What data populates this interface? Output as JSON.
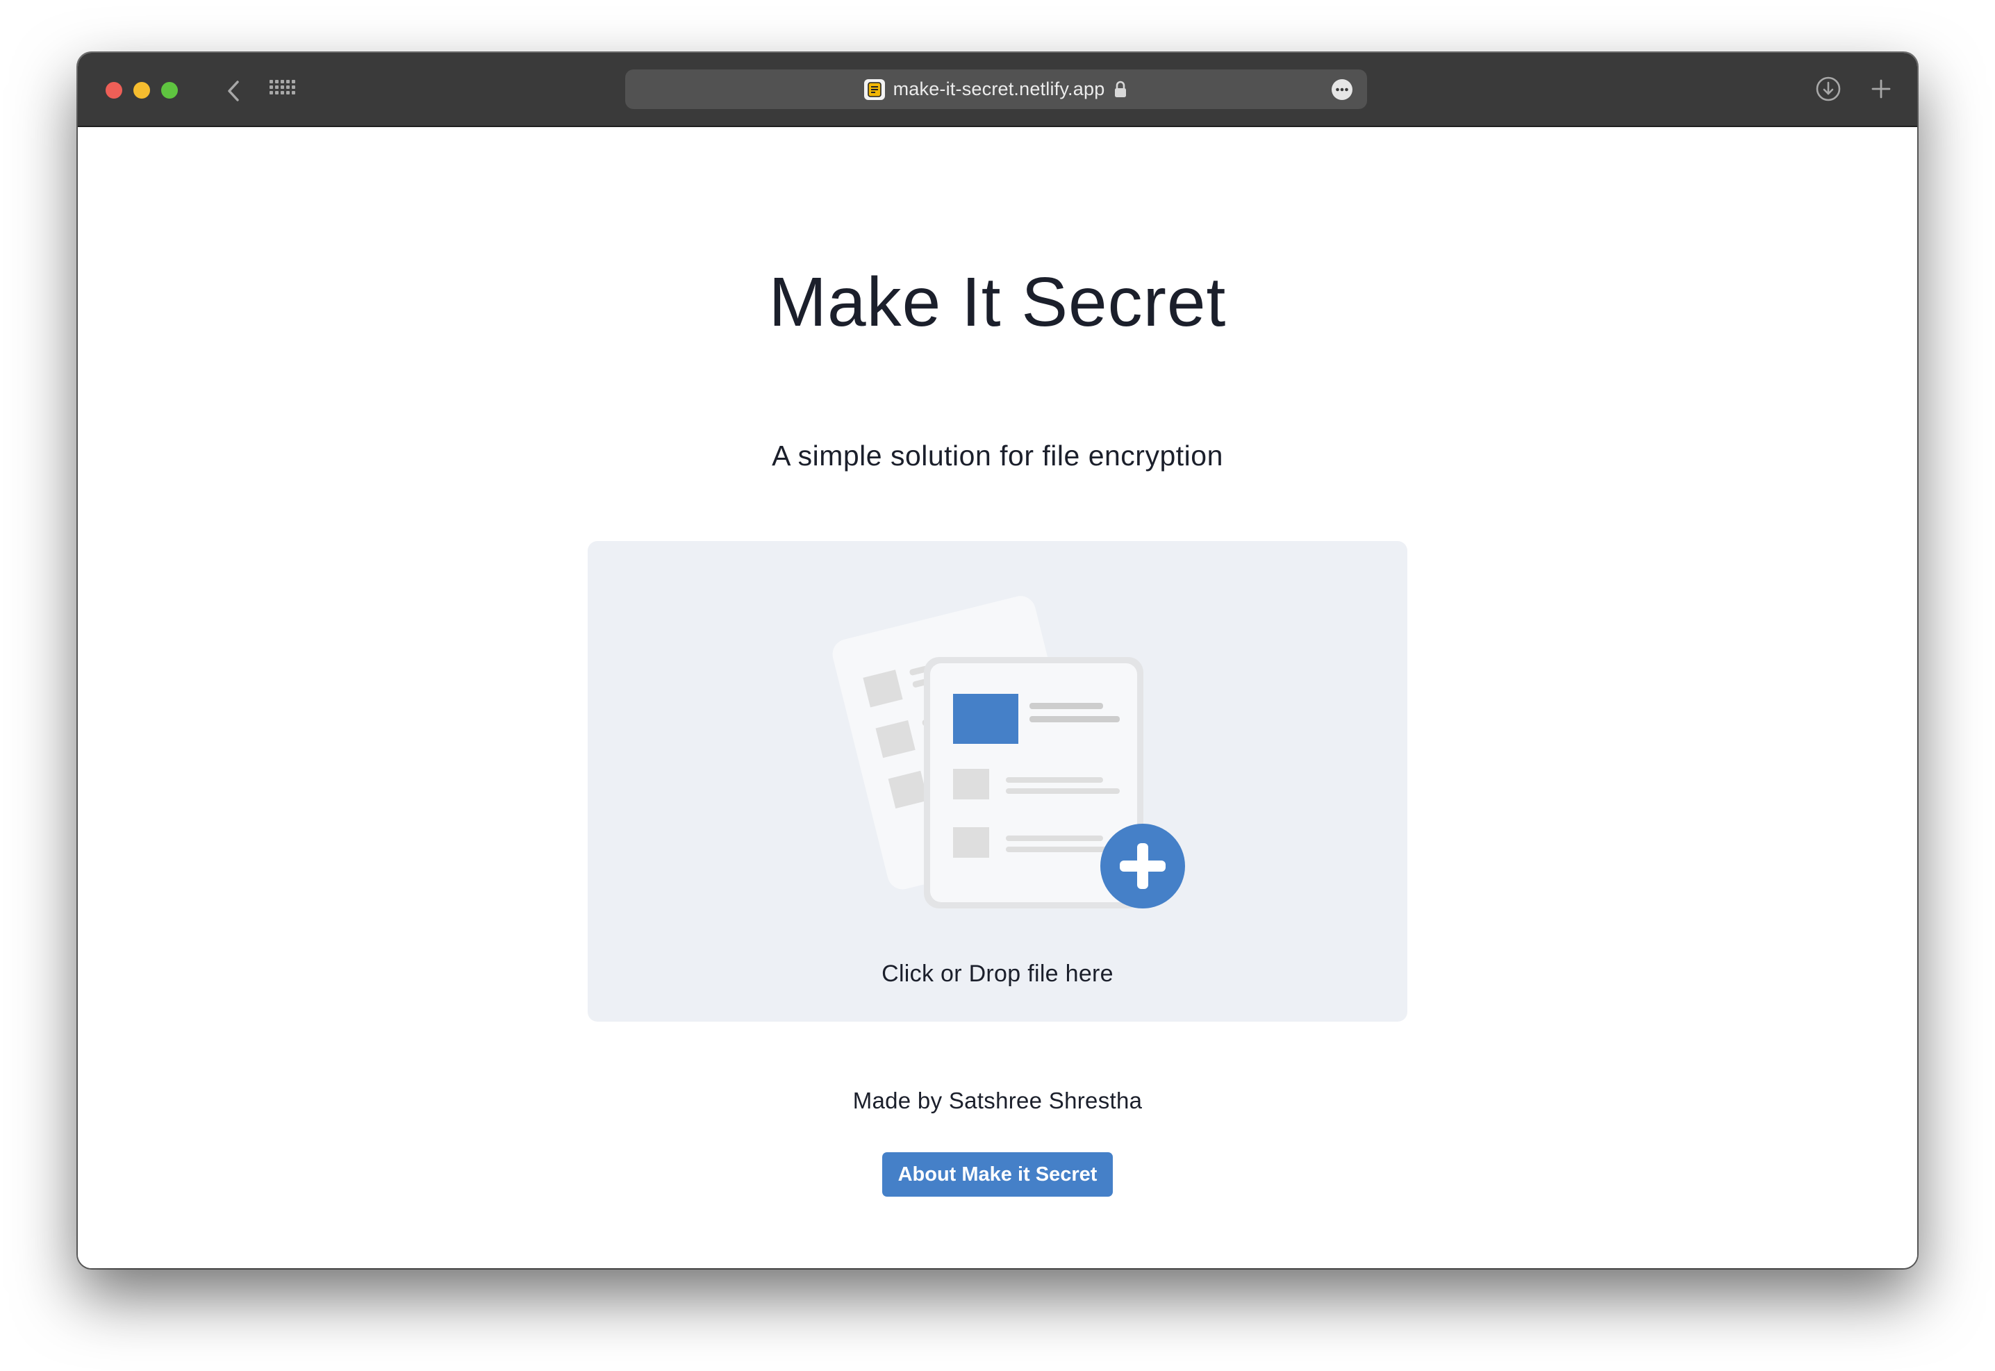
{
  "browser": {
    "url": "make-it-secret.netlify.app",
    "icons": {
      "back": "chevron-left-icon",
      "grid": "grid-icon",
      "lock": "lock-icon",
      "more": "ellipsis-circle-icon",
      "download": "download-icon",
      "new_tab": "plus-icon"
    }
  },
  "page": {
    "title": "Make It Secret",
    "subtitle": "A simple solution for file encryption",
    "dropzone_label": "Click or Drop file here",
    "made_by": "Made by Satshree Shrestha",
    "about_button": "About Make it Secret"
  },
  "colors": {
    "accent": "#4580c8",
    "dropzone_bg": "#edf0f5",
    "title_text": "#1b1f2b",
    "titlebar": "#3a3a3a"
  }
}
